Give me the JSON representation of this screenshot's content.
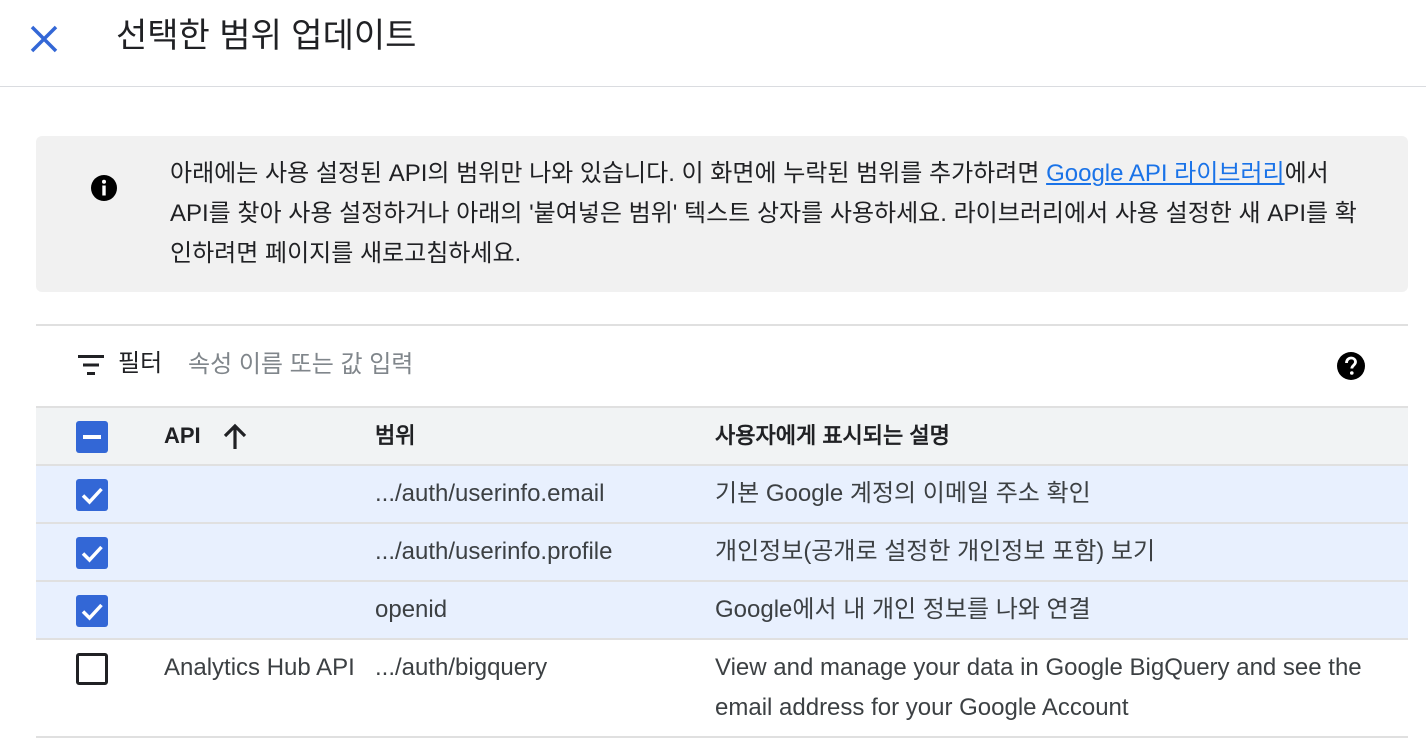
{
  "header": {
    "title": "선택한 범위 업데이트",
    "close_icon": "close-icon"
  },
  "notice": {
    "icon": "info-icon",
    "text_before_link": "아래에는 사용 설정된 API의 범위만 나와 있습니다. 이 화면에 누락된 범위를 추가하려면 ",
    "link_text": "Google API 라이브러리",
    "text_after_link": "에서 API를 찾아 사용 설정하거나 아래의 '붙여넣은 범위' 텍스트 상자를 사용하세요. 라이브러리에서 사용 설정한 새 API를 확인하려면 페이지를 새로고침하세요."
  },
  "filter": {
    "icon": "filter-icon",
    "label": "필터",
    "placeholder": "속성 이름 또는 값 입력",
    "help_icon": "help-icon"
  },
  "table": {
    "columns": {
      "api": "API",
      "scope": "범위",
      "description": "사용자에게 표시되는 설명"
    },
    "sort_icon": "arrow-upward-icon",
    "header_checkbox_state": "indeterminate",
    "rows": [
      {
        "api": "",
        "scope": ".../auth/userinfo.email",
        "description": "기본 Google 계정의 이메일 주소 확인",
        "checked": true
      },
      {
        "api": "",
        "scope": ".../auth/userinfo.profile",
        "description": "개인정보(공개로 설정한 개인정보 포함) 보기",
        "checked": true
      },
      {
        "api": "",
        "scope": "openid",
        "description": "Google에서 내 개인 정보를 나와 연결",
        "checked": true
      },
      {
        "api": "Analytics Hub API",
        "scope": ".../auth/bigquery",
        "description": "View and manage your data in Google BigQuery and see the email address for your Google Account",
        "checked": false
      }
    ]
  },
  "colors": {
    "accent": "#3367d6",
    "link": "#1a73e8",
    "selected_row": "#e8f0fe",
    "notice_bg": "#f1f1f1"
  }
}
